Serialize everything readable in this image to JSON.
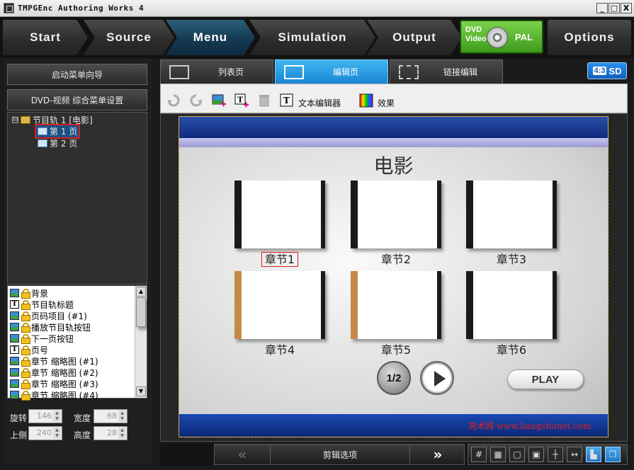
{
  "window": {
    "title": "TMPGEnc Authoring Works 4",
    "buttons": {
      "minimize": "_",
      "maximize": "□",
      "close": "X"
    }
  },
  "nav": {
    "steps": [
      "Start",
      "Source",
      "Menu",
      "Simulation",
      "Output"
    ],
    "active": "Menu",
    "disc_badge": {
      "line1": "DVD",
      "line2": "Video",
      "format": "PAL"
    },
    "options": "Options"
  },
  "left": {
    "wizard_button": "启动菜单向导",
    "settings_button": "DVD-视频 综合菜单设置",
    "tree": {
      "root_label": "节目轨 1 [电影]",
      "expander": "⊟",
      "pages": [
        "第 1 页",
        "第 2 页"
      ],
      "selected_page": "第 1 页"
    },
    "layers": [
      {
        "type": "image",
        "label": "背景"
      },
      {
        "type": "text",
        "label": "节目轨标题"
      },
      {
        "type": "image",
        "label": "页码项目 (#1)"
      },
      {
        "type": "image",
        "label": "播放节目轨按钮"
      },
      {
        "type": "image",
        "label": "下一页按钮"
      },
      {
        "type": "text",
        "label": "页号"
      },
      {
        "type": "image",
        "label": "章节 缩略图 (#1)"
      },
      {
        "type": "image",
        "label": "章节 缩略图 (#2)"
      },
      {
        "type": "image",
        "label": "章节 缩略图 (#3)"
      },
      {
        "type": "image",
        "label": "章节 缩略图 (#4)"
      }
    ],
    "properties": {
      "rotate_label": "旋转",
      "rotate_value": "146",
      "width_label": "宽度",
      "width_value": "68",
      "top_label": "上侧",
      "top_value": "240",
      "height_label": "高度",
      "height_value": "28"
    }
  },
  "tabs": {
    "items": [
      "列表页",
      "编辑页",
      "链接编辑"
    ],
    "active": "编辑页",
    "aspect": {
      "ratio": "4:3",
      "mode": "SD"
    }
  },
  "toolbar": {
    "icons": [
      "undo-icon",
      "redo-icon",
      "add-image-icon",
      "add-text-icon",
      "delete-icon"
    ],
    "text_editor_label": "文本编辑器",
    "text_editor_glyph": "T",
    "effects_label": "效果"
  },
  "menu_preview": {
    "title": "电影",
    "chapters": [
      "章节1",
      "章节2",
      "章节3",
      "章节4",
      "章节5",
      "章节6"
    ],
    "page_indicator": "1/2",
    "play_label": "PLAY",
    "watermark": "亮术网 www.liangshunet.com",
    "colors": {
      "band": "#0d2a7e",
      "stripe": "#9b98d6",
      "selection": "#d42020"
    }
  },
  "bottom": {
    "prev_glyph": "«",
    "clip_options": "剪辑选项",
    "next_glyph": "»",
    "view_icons": [
      "grid-icon",
      "grid-fine-icon",
      "safe-area-icon",
      "fit-icon",
      "center-icon",
      "stretch-icon",
      "align-left-icon",
      "copy-icon"
    ],
    "resize_glyph": "↔"
  }
}
